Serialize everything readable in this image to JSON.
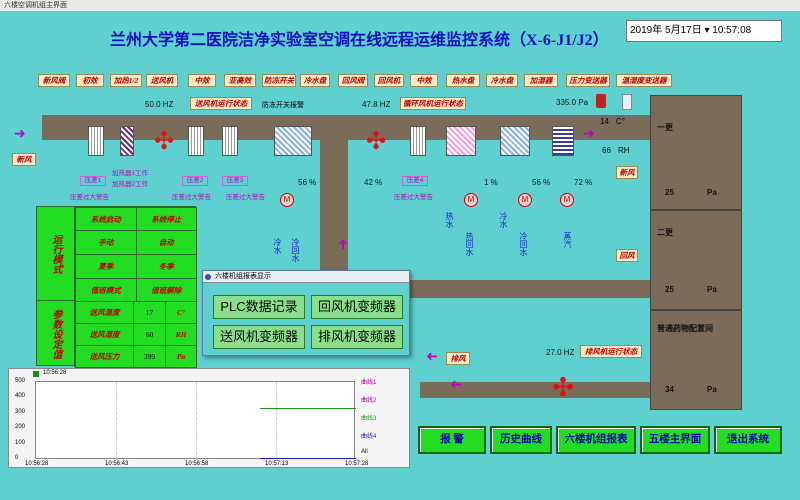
{
  "window_title": "六楼空调机组主界面",
  "title": "兰州大学第二医院洁净实验室空调在线远程运维监控系统（X-6-J1/J2）",
  "datetime": "2019年  5月17日  ▾  10:57:08",
  "top_tags": [
    "新风阀",
    "初效",
    "加热1/2",
    "送风机",
    "中效",
    "亚高效",
    "防冻开关",
    "冷水盘",
    "回风阀",
    "回风机",
    "中效",
    "热水盘",
    "冷水盘",
    "加湿器",
    "压力变送器",
    "温湿度变送器"
  ],
  "supply_freq": "50.0  HZ",
  "supply_status": "送风机运行状态",
  "freeze_alarm": "防冻开关报警",
  "return_freq": "47.8  HZ",
  "return_status": "循环风机运行状态",
  "pressure_tx": "335.0  Pa",
  "temp_val": "14",
  "temp_unit": "C°",
  "rh_val": "66",
  "rh_unit": "RH",
  "fresh_air": "新风",
  "diff1": "压差1",
  "diff2": "压差2",
  "diff3": "压差3",
  "diff4": "压差4",
  "diff_alarm": "压差过大警告",
  "heater1": "加热器1工作",
  "heater2": "加热器2工作",
  "valve1_pct": "56  %",
  "valve_left_pct": "42  %",
  "valve2_pct": "1  %",
  "valve3_pct": "56  %",
  "valve4_pct": "72  %",
  "cold_water": "冷水",
  "cold_return": "冷回水",
  "hot_water": "热水",
  "hot_return": "热回水",
  "cold_water2": "冷水",
  "cold_return2": "冷回水",
  "steam": "蒸汽",
  "room1_name": "一更",
  "room1_pa": "25",
  "room2_name": "二更",
  "room2_pa": "25",
  "room3_name": "普通药物配置间",
  "room3_pa": "34",
  "pa": "Pa",
  "xinfeng_r": "新风",
  "huifeng_r": "回风",
  "paifeng": "排风",
  "exhaust_freq": "27.0  HZ",
  "exhaust_status": "排风机运行状态",
  "mode_panel": {
    "label_run": "运行模式",
    "label_param": "参数设定值",
    "r1": [
      "系统启动",
      "系统停止"
    ],
    "r2": [
      "手动",
      "自动"
    ],
    "r3": [
      "夏季",
      "冬季"
    ],
    "r4": [
      "值班模式",
      "值班解除"
    ],
    "p1": [
      "送风温度",
      "17",
      "C°"
    ],
    "p2": [
      "送风湿度",
      "60",
      "RH"
    ],
    "p3": [
      "送风压力",
      "399",
      "Pa"
    ]
  },
  "popup": {
    "title": "六楼机组报表显示",
    "b1": "PLC数据记录",
    "b2": "回风机变频器",
    "b3": "送风机变频器",
    "b4": "排风机变频器"
  },
  "trend": {
    "top_time": "10:56:28",
    "yticks": [
      "500",
      "400",
      "300",
      "200",
      "100",
      "0"
    ],
    "xticks": [
      "10:56:28",
      "10:56:43",
      "10:56:58",
      "10:57:13",
      "10:57:28"
    ],
    "legend": [
      "曲线1",
      "曲线2",
      "曲线3",
      "曲线4",
      "All"
    ]
  },
  "buttons": [
    "报    警",
    "历史曲线",
    "六楼机组报表",
    "五楼主界面",
    "退出系统"
  ]
}
